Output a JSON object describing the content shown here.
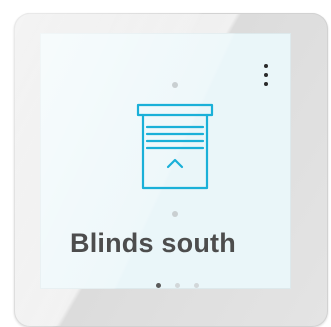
{
  "tile": {
    "label": "Blinds south",
    "icon": "blinds-up-icon",
    "accent_color": "#1ab0d8",
    "text_color": "#4d4d4d"
  },
  "menu": {
    "icon": "more-vertical-icon"
  },
  "pagination": {
    "pages": 3,
    "current": 1
  }
}
